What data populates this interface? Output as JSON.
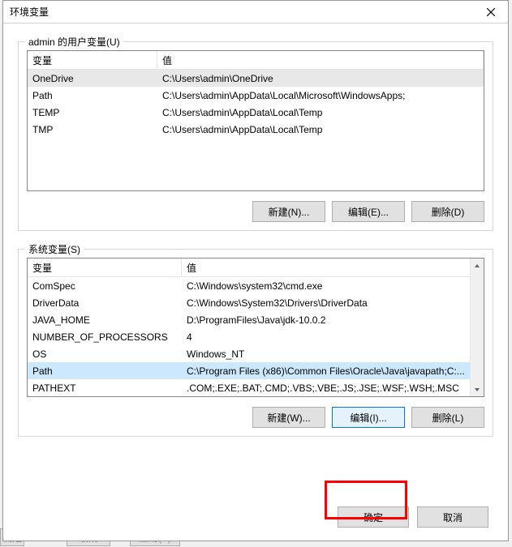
{
  "window": {
    "title": "环境变量"
  },
  "user_section": {
    "label": "admin 的用户变量(U)",
    "headers": {
      "var": "变量",
      "val": "值"
    },
    "rows": [
      {
        "var": "OneDrive",
        "val": "C:\\Users\\admin\\OneDrive",
        "selected": true
      },
      {
        "var": "Path",
        "val": "C:\\Users\\admin\\AppData\\Local\\Microsoft\\WindowsApps;"
      },
      {
        "var": "TEMP",
        "val": "C:\\Users\\admin\\AppData\\Local\\Temp"
      },
      {
        "var": "TMP",
        "val": "C:\\Users\\admin\\AppData\\Local\\Temp"
      }
    ],
    "buttons": {
      "new": "新建(N)...",
      "edit": "编辑(E)...",
      "delete": "删除(D)"
    }
  },
  "sys_section": {
    "label": "系统变量(S)",
    "headers": {
      "var": "变量",
      "val": "值"
    },
    "rows": [
      {
        "var": "ComSpec",
        "val": "C:\\Windows\\system32\\cmd.exe"
      },
      {
        "var": "DriverData",
        "val": "C:\\Windows\\System32\\Drivers\\DriverData"
      },
      {
        "var": "JAVA_HOME",
        "val": "D:\\ProgramFiles\\Java\\jdk-10.0.2"
      },
      {
        "var": "NUMBER_OF_PROCESSORS",
        "val": "4"
      },
      {
        "var": "OS",
        "val": "Windows_NT"
      },
      {
        "var": "Path",
        "val": "C:\\Program Files (x86)\\Common Files\\Oracle\\Java\\javapath;C:...",
        "selected": true
      },
      {
        "var": "PATHEXT",
        "val": ".COM;.EXE;.BAT;.CMD;.VBS;.VBE;.JS;.JSE;.WSF;.WSH;.MSC"
      }
    ],
    "buttons": {
      "new": "新建(W)...",
      "edit": "编辑(I)...",
      "delete": "删除(L)"
    }
  },
  "dialog_buttons": {
    "ok": "确定",
    "cancel": "取消"
  },
  "bg": {
    "ok": "确定",
    "cancel": "取消",
    "apply": "应用(A)"
  }
}
